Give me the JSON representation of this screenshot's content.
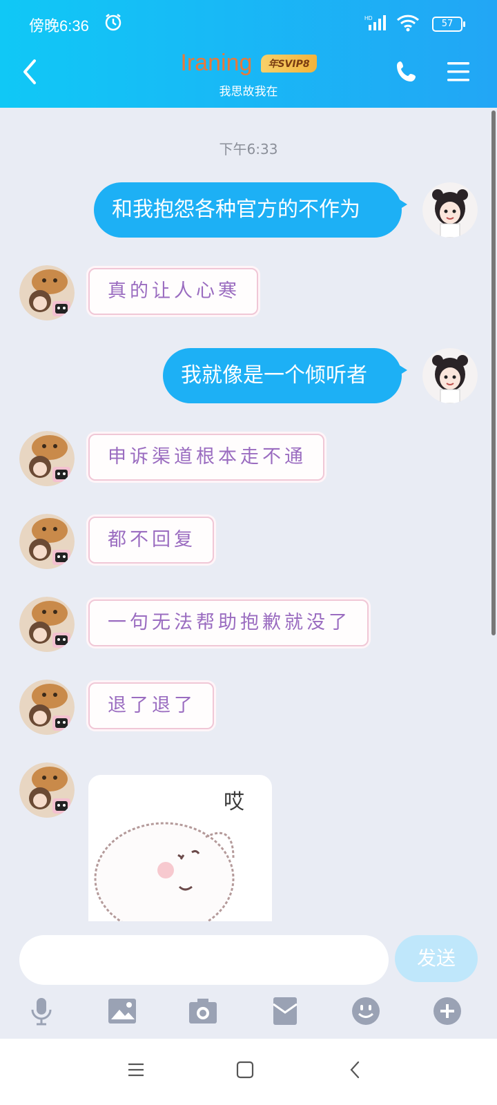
{
  "status_bar": {
    "time": "傍晚6:36",
    "battery": "57"
  },
  "header": {
    "title": "Iraning",
    "vip_badge": "年SVIP8",
    "subtitle": "我思故我在"
  },
  "chat": {
    "timestamp": "下午6:33",
    "messages": [
      {
        "from": "me",
        "text": "和我抱怨各种官方的不作为"
      },
      {
        "from": "other",
        "text": "真的让人心寒"
      },
      {
        "from": "me",
        "text": "我就像是一个倾听者"
      },
      {
        "from": "other",
        "text": "申诉渠道根本走不通"
      },
      {
        "from": "other",
        "text": "都不回复"
      },
      {
        "from": "other",
        "text": "一句无法帮助抱歉就没了"
      },
      {
        "from": "other",
        "text": "退了退了"
      },
      {
        "from": "other",
        "sticker_text": "哎"
      }
    ]
  },
  "input_bar": {
    "placeholder": "",
    "send_label": "发送"
  },
  "colors": {
    "header_start": "#10c8f6",
    "header_end": "#22a6f5",
    "outgoing_bubble": "#1db0f5",
    "incoming_text": "#9a6cc0",
    "send_button": "#bfe7fb"
  },
  "icons": [
    "back-icon",
    "phone-icon",
    "menu-icon",
    "microphone-icon",
    "image-icon",
    "camera-icon",
    "red-packet-icon",
    "emoji-icon",
    "plus-icon"
  ]
}
